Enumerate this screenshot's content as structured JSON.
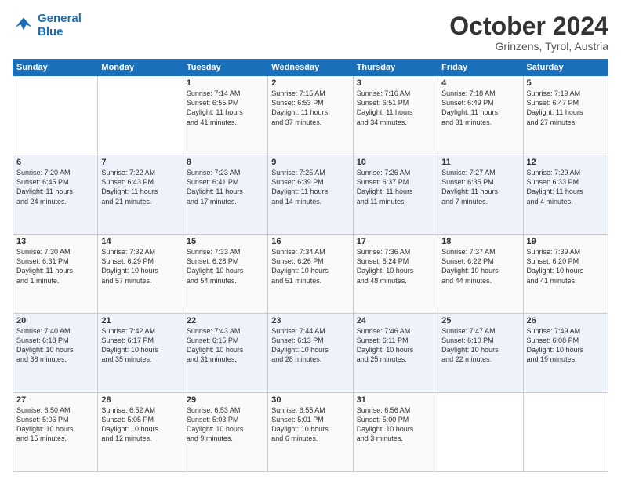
{
  "logo": {
    "line1": "General",
    "line2": "Blue"
  },
  "title": "October 2024",
  "location": "Grinzens, Tyrol, Austria",
  "days_of_week": [
    "Sunday",
    "Monday",
    "Tuesday",
    "Wednesday",
    "Thursday",
    "Friday",
    "Saturday"
  ],
  "weeks": [
    [
      {
        "day": "",
        "info": ""
      },
      {
        "day": "",
        "info": ""
      },
      {
        "day": "1",
        "info": "Sunrise: 7:14 AM\nSunset: 6:55 PM\nDaylight: 11 hours\nand 41 minutes."
      },
      {
        "day": "2",
        "info": "Sunrise: 7:15 AM\nSunset: 6:53 PM\nDaylight: 11 hours\nand 37 minutes."
      },
      {
        "day": "3",
        "info": "Sunrise: 7:16 AM\nSunset: 6:51 PM\nDaylight: 11 hours\nand 34 minutes."
      },
      {
        "day": "4",
        "info": "Sunrise: 7:18 AM\nSunset: 6:49 PM\nDaylight: 11 hours\nand 31 minutes."
      },
      {
        "day": "5",
        "info": "Sunrise: 7:19 AM\nSunset: 6:47 PM\nDaylight: 11 hours\nand 27 minutes."
      }
    ],
    [
      {
        "day": "6",
        "info": "Sunrise: 7:20 AM\nSunset: 6:45 PM\nDaylight: 11 hours\nand 24 minutes."
      },
      {
        "day": "7",
        "info": "Sunrise: 7:22 AM\nSunset: 6:43 PM\nDaylight: 11 hours\nand 21 minutes."
      },
      {
        "day": "8",
        "info": "Sunrise: 7:23 AM\nSunset: 6:41 PM\nDaylight: 11 hours\nand 17 minutes."
      },
      {
        "day": "9",
        "info": "Sunrise: 7:25 AM\nSunset: 6:39 PM\nDaylight: 11 hours\nand 14 minutes."
      },
      {
        "day": "10",
        "info": "Sunrise: 7:26 AM\nSunset: 6:37 PM\nDaylight: 11 hours\nand 11 minutes."
      },
      {
        "day": "11",
        "info": "Sunrise: 7:27 AM\nSunset: 6:35 PM\nDaylight: 11 hours\nand 7 minutes."
      },
      {
        "day": "12",
        "info": "Sunrise: 7:29 AM\nSunset: 6:33 PM\nDaylight: 11 hours\nand 4 minutes."
      }
    ],
    [
      {
        "day": "13",
        "info": "Sunrise: 7:30 AM\nSunset: 6:31 PM\nDaylight: 11 hours\nand 1 minute."
      },
      {
        "day": "14",
        "info": "Sunrise: 7:32 AM\nSunset: 6:29 PM\nDaylight: 10 hours\nand 57 minutes."
      },
      {
        "day": "15",
        "info": "Sunrise: 7:33 AM\nSunset: 6:28 PM\nDaylight: 10 hours\nand 54 minutes."
      },
      {
        "day": "16",
        "info": "Sunrise: 7:34 AM\nSunset: 6:26 PM\nDaylight: 10 hours\nand 51 minutes."
      },
      {
        "day": "17",
        "info": "Sunrise: 7:36 AM\nSunset: 6:24 PM\nDaylight: 10 hours\nand 48 minutes."
      },
      {
        "day": "18",
        "info": "Sunrise: 7:37 AM\nSunset: 6:22 PM\nDaylight: 10 hours\nand 44 minutes."
      },
      {
        "day": "19",
        "info": "Sunrise: 7:39 AM\nSunset: 6:20 PM\nDaylight: 10 hours\nand 41 minutes."
      }
    ],
    [
      {
        "day": "20",
        "info": "Sunrise: 7:40 AM\nSunset: 6:18 PM\nDaylight: 10 hours\nand 38 minutes."
      },
      {
        "day": "21",
        "info": "Sunrise: 7:42 AM\nSunset: 6:17 PM\nDaylight: 10 hours\nand 35 minutes."
      },
      {
        "day": "22",
        "info": "Sunrise: 7:43 AM\nSunset: 6:15 PM\nDaylight: 10 hours\nand 31 minutes."
      },
      {
        "day": "23",
        "info": "Sunrise: 7:44 AM\nSunset: 6:13 PM\nDaylight: 10 hours\nand 28 minutes."
      },
      {
        "day": "24",
        "info": "Sunrise: 7:46 AM\nSunset: 6:11 PM\nDaylight: 10 hours\nand 25 minutes."
      },
      {
        "day": "25",
        "info": "Sunrise: 7:47 AM\nSunset: 6:10 PM\nDaylight: 10 hours\nand 22 minutes."
      },
      {
        "day": "26",
        "info": "Sunrise: 7:49 AM\nSunset: 6:08 PM\nDaylight: 10 hours\nand 19 minutes."
      }
    ],
    [
      {
        "day": "27",
        "info": "Sunrise: 6:50 AM\nSunset: 5:06 PM\nDaylight: 10 hours\nand 15 minutes."
      },
      {
        "day": "28",
        "info": "Sunrise: 6:52 AM\nSunset: 5:05 PM\nDaylight: 10 hours\nand 12 minutes."
      },
      {
        "day": "29",
        "info": "Sunrise: 6:53 AM\nSunset: 5:03 PM\nDaylight: 10 hours\nand 9 minutes."
      },
      {
        "day": "30",
        "info": "Sunrise: 6:55 AM\nSunset: 5:01 PM\nDaylight: 10 hours\nand 6 minutes."
      },
      {
        "day": "31",
        "info": "Sunrise: 6:56 AM\nSunset: 5:00 PM\nDaylight: 10 hours\nand 3 minutes."
      },
      {
        "day": "",
        "info": ""
      },
      {
        "day": "",
        "info": ""
      }
    ]
  ]
}
